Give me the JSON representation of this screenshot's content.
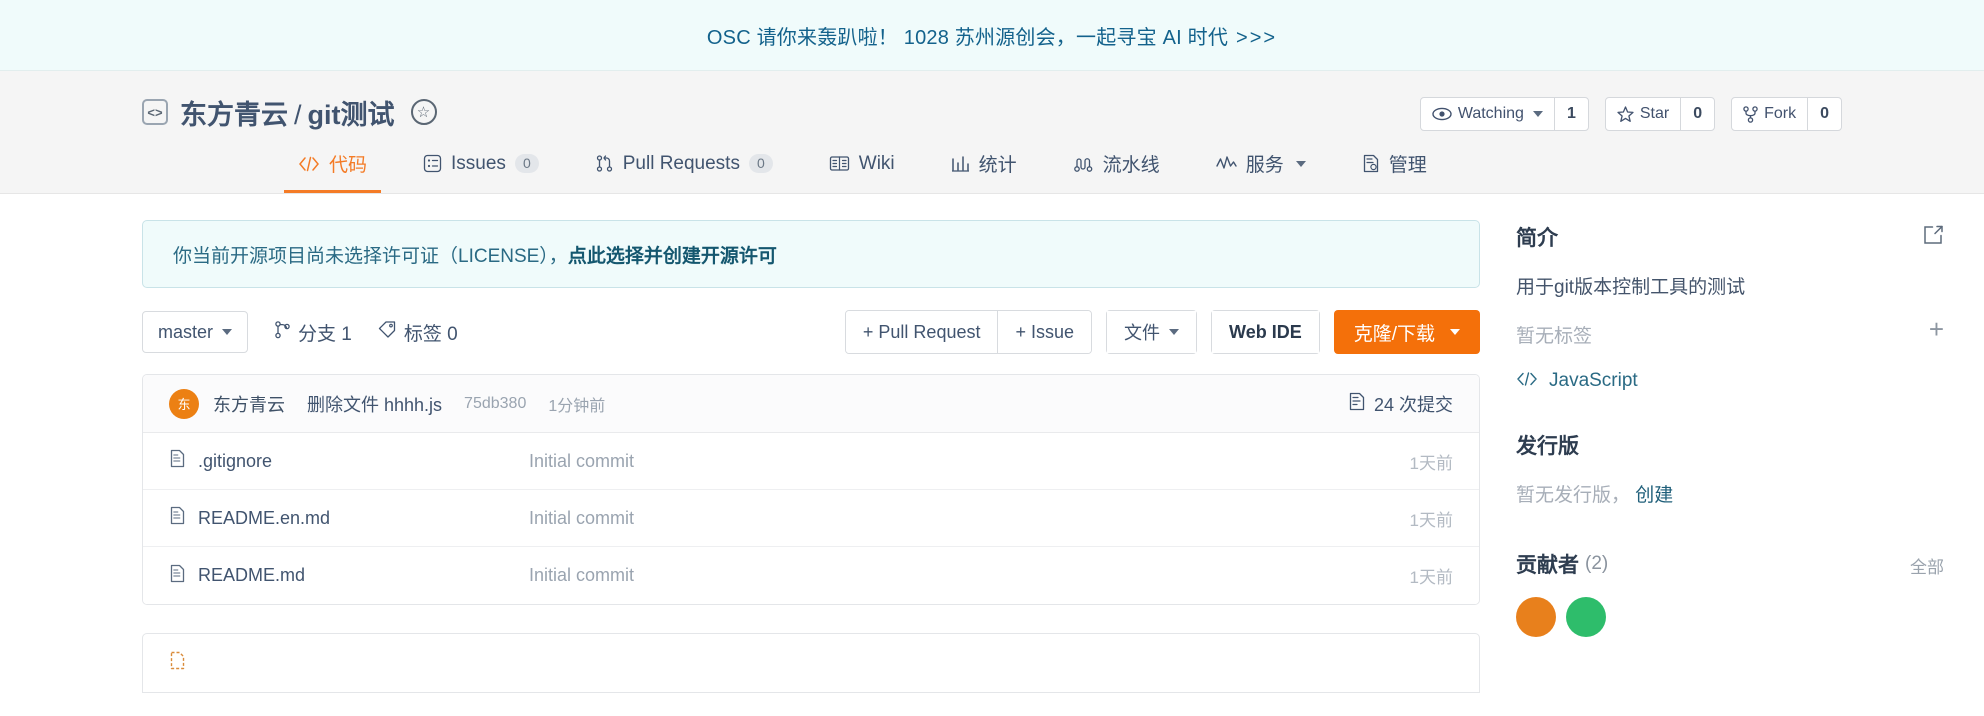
{
  "promo": {
    "text": "OSC 请你来轰趴啦！ 1028 苏州源创会，一起寻宝 AI 时代",
    "arrows": ">>>"
  },
  "repo": {
    "owner": "东方青云",
    "separator": "/",
    "name": "git测试",
    "repo_icon": "code-brackets-icon",
    "badge_icon": "star-circle-icon"
  },
  "repo_actions": {
    "watching_label": "Watching",
    "watching_count": "1",
    "star_label": "Star",
    "star_count": "0",
    "fork_label": "Fork",
    "fork_count": "0"
  },
  "nav": {
    "tabs": [
      {
        "label": "代码",
        "icon": "code-icon",
        "count": null,
        "active": true
      },
      {
        "label": "Issues",
        "icon": "issue-list-icon",
        "count": "0",
        "active": false
      },
      {
        "label": "Pull Requests",
        "icon": "pull-request-icon",
        "count": "0",
        "active": false
      },
      {
        "label": "Wiki",
        "icon": "book-icon",
        "count": null,
        "active": false
      },
      {
        "label": "统计",
        "icon": "chart-icon",
        "count": null,
        "active": false
      },
      {
        "label": "流水线",
        "icon": "pipeline-icon",
        "count": null,
        "active": false
      },
      {
        "label": "服务",
        "icon": "activity-icon",
        "count": null,
        "active": false,
        "caret": true
      },
      {
        "label": "管理",
        "icon": "settings-doc-icon",
        "count": null,
        "active": false
      }
    ]
  },
  "license_notice": {
    "text": "你当前开源项目尚未选择许可证（LICENSE），",
    "link": "点此选择并创建开源许可"
  },
  "toolbar": {
    "branch": "master",
    "branches_label": "分支 1",
    "tags_label": "标签 0",
    "pull_request_label": "+ Pull Request",
    "issue_label": "+ Issue",
    "files_label": "文件",
    "web_ide_label": "Web IDE",
    "clone_label": "克隆/下载"
  },
  "commit_bar": {
    "avatar_initial": "东",
    "avatar_color": "#ec8013",
    "author": "东方青云",
    "message": "删除文件 hhhh.js",
    "sha": "75db380",
    "time": "1分钟前",
    "commits_label": "24 次提交"
  },
  "files": {
    "rows": [
      {
        "name": ".gitignore",
        "commit": "Initial commit",
        "time": "1天前",
        "icon": "file-icon"
      },
      {
        "name": "README.en.md",
        "commit": "Initial commit",
        "time": "1天前",
        "icon": "file-icon"
      },
      {
        "name": "README.md",
        "commit": "Initial commit",
        "time": "1天前",
        "icon": "file-icon"
      }
    ]
  },
  "sidebar": {
    "about_title": "简介",
    "about_edit_icon": "edit-icon",
    "description": "用于git版本控制工具的测试",
    "no_tags": "暂无标签",
    "add_tag_icon": "plus-icon",
    "language": "JavaScript",
    "language_icon": "code-icon",
    "releases_title": "发行版",
    "no_releases": "暂无发行版，",
    "create_release": "创建",
    "contributors_title": "贡献者",
    "contributors_count": "(2)",
    "contributors_all": "全部",
    "contributor_colors": [
      "#e8801c",
      "#2ebd6b"
    ]
  },
  "colors": {
    "accent_orange": "#f4700a",
    "brand_blue": "#13628c",
    "text_slate": "#41546f",
    "banner_bg": "#f0fbfb"
  }
}
